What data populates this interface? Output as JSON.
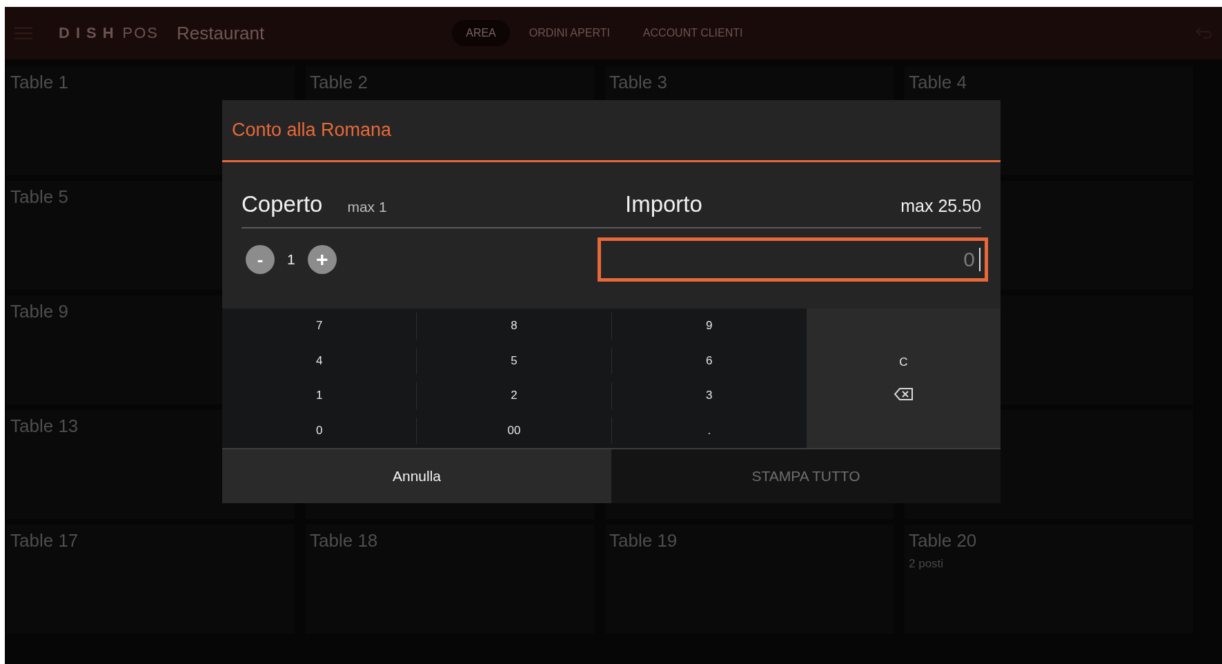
{
  "top_bar": {
    "brand_bold": "DISH",
    "brand_light": "POS",
    "section": "Restaurant",
    "tabs": [
      {
        "label": "AREA",
        "selected": true
      },
      {
        "label": "ORDINI APERTI",
        "selected": false
      },
      {
        "label": "ACCOUNT CLIENTI",
        "selected": false
      }
    ]
  },
  "table_rows": [
    {
      "tables": [
        {
          "label": "Table 1"
        },
        {
          "label": "Table 2"
        },
        {
          "label": "Table 3"
        },
        {
          "label": "Table 4"
        }
      ]
    },
    {
      "tables": [
        {
          "label": "Table 5"
        }
      ]
    },
    {
      "tables": [
        {
          "label": "Table 9"
        }
      ]
    },
    {
      "tables": [
        {
          "label": "Table 13"
        }
      ]
    },
    {
      "tables": [
        {
          "label": "Table 17"
        },
        {
          "label": "Table 18"
        },
        {
          "label": "Table 19"
        },
        {
          "label": "Table 20",
          "seats": "2 posti"
        }
      ]
    }
  ],
  "dialog": {
    "title": "Conto alla Romana",
    "covers": {
      "label": "Coperto",
      "max": "max 1",
      "minus": "-",
      "value": "1",
      "plus": "+"
    },
    "amount": {
      "label": "Importo",
      "max": "max 25.50",
      "placeholder": "0",
      "focused": true
    },
    "keypad": {
      "keys": [
        "7",
        "8",
        "9",
        "4",
        "5",
        "6",
        "1",
        "2",
        "3",
        "0",
        "00",
        "."
      ],
      "side_keys": [
        {
          "kind": "text",
          "label": "C"
        },
        {
          "kind": "backspace"
        }
      ]
    },
    "buttons": [
      {
        "label": "Annulla",
        "disabled": false
      },
      {
        "label": "STAMPA TUTTO",
        "disabled": true
      }
    ]
  }
}
